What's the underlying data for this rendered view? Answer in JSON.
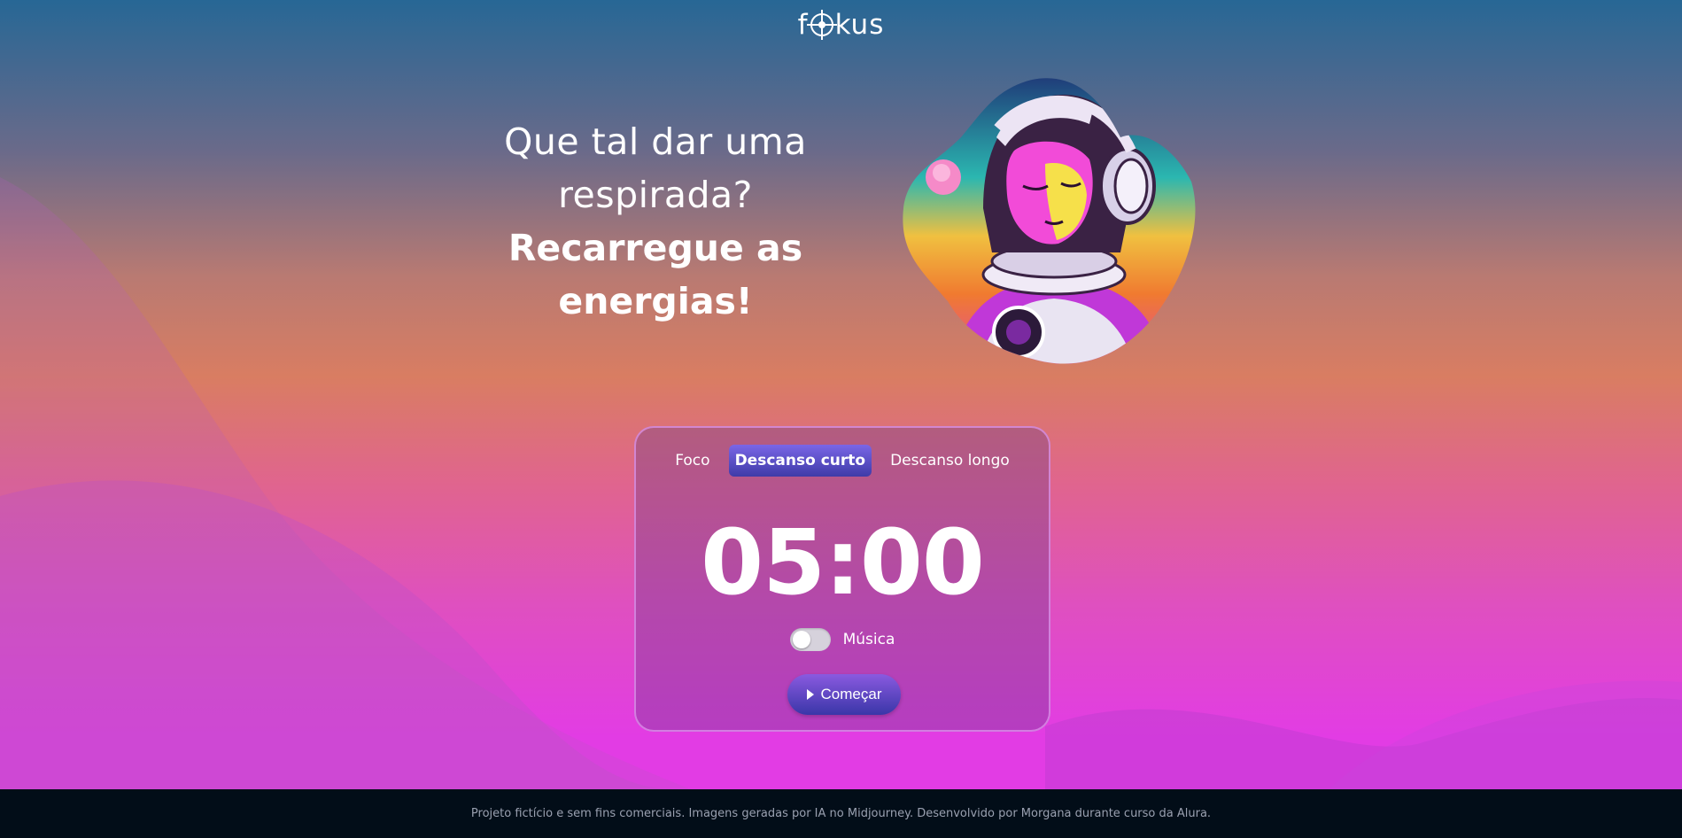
{
  "header": {
    "logo_text_before": "f",
    "logo_text_after": "kus"
  },
  "hero": {
    "line1": "Que tal dar uma",
    "line2": "respirada?",
    "line3": "Recarregue as",
    "line4": "energias!"
  },
  "timer_card": {
    "tabs": [
      {
        "label": "Foco",
        "active": false
      },
      {
        "label": "Descanso curto",
        "active": true
      },
      {
        "label": "Descanso longo",
        "active": false
      }
    ],
    "time": "05:00",
    "music_label": "Música",
    "music_enabled": false,
    "start_label": "Começar"
  },
  "footer": {
    "text": "Projeto fictício e sem fins comerciais. Imagens geradas por IA no Midjourney. Desenvolvido por Morgana durante curso da Alura."
  },
  "colors": {
    "top": "#276795",
    "bottom": "#e23ce4",
    "active_tab": "#5a4fcf",
    "footer_bg": "#020d18"
  }
}
